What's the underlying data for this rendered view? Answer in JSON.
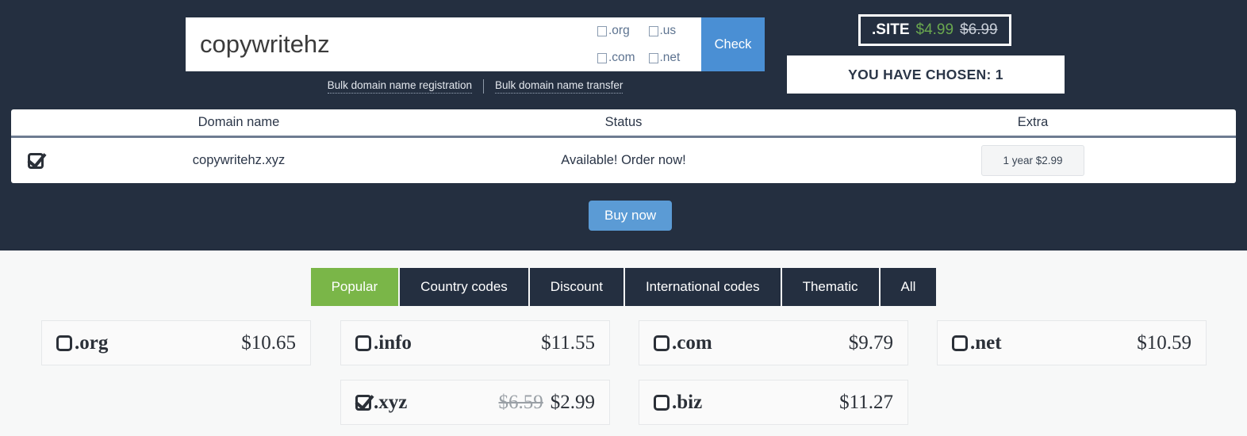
{
  "search": {
    "value": "copywritehz",
    "placeholder": "Enter domain name",
    "check_label": "Check",
    "quick_tlds": [
      {
        "label": ".org",
        "checked": false
      },
      {
        "label": ".us",
        "checked": false
      },
      {
        "label": ".com",
        "checked": false
      },
      {
        "label": ".net",
        "checked": false
      }
    ]
  },
  "bulk": {
    "registration": "Bulk domain name registration",
    "transfer": "Bulk domain name transfer"
  },
  "promo": {
    "tld": ".SITE",
    "new_price": "$4.99",
    "old_price": "$6.99",
    "accent_color": "#6aa84f"
  },
  "chosen": {
    "label": "YOU HAVE CHOSEN: 1"
  },
  "results": {
    "columns": [
      "Domain name",
      "Status",
      "Extra"
    ],
    "rows": [
      {
        "checked": true,
        "domain": "copywritehz.xyz",
        "status": "Available! Order now!",
        "extra": "1 year $2.99"
      }
    ]
  },
  "buy": {
    "label": "Buy now",
    "color": "#5b9bd5"
  },
  "tabs": {
    "active": "Popular",
    "active_color": "#7ab648",
    "items": [
      "Popular",
      "Country codes",
      "Discount",
      "International codes",
      "Thematic",
      "All"
    ]
  },
  "tld_cards": [
    {
      "tld": ".org",
      "price": "$10.65",
      "old_price": "",
      "checked": false
    },
    {
      "tld": ".info",
      "price": "$11.55",
      "old_price": "",
      "checked": false
    },
    {
      "tld": ".com",
      "price": "$9.79",
      "old_price": "",
      "checked": false
    },
    {
      "tld": ".net",
      "price": "$10.59",
      "old_price": "",
      "checked": false
    },
    {
      "tld": ".xyz",
      "price": "$2.99",
      "old_price": "$6.59",
      "checked": true
    },
    {
      "tld": ".biz",
      "price": "$11.27",
      "old_price": "",
      "checked": false
    }
  ]
}
